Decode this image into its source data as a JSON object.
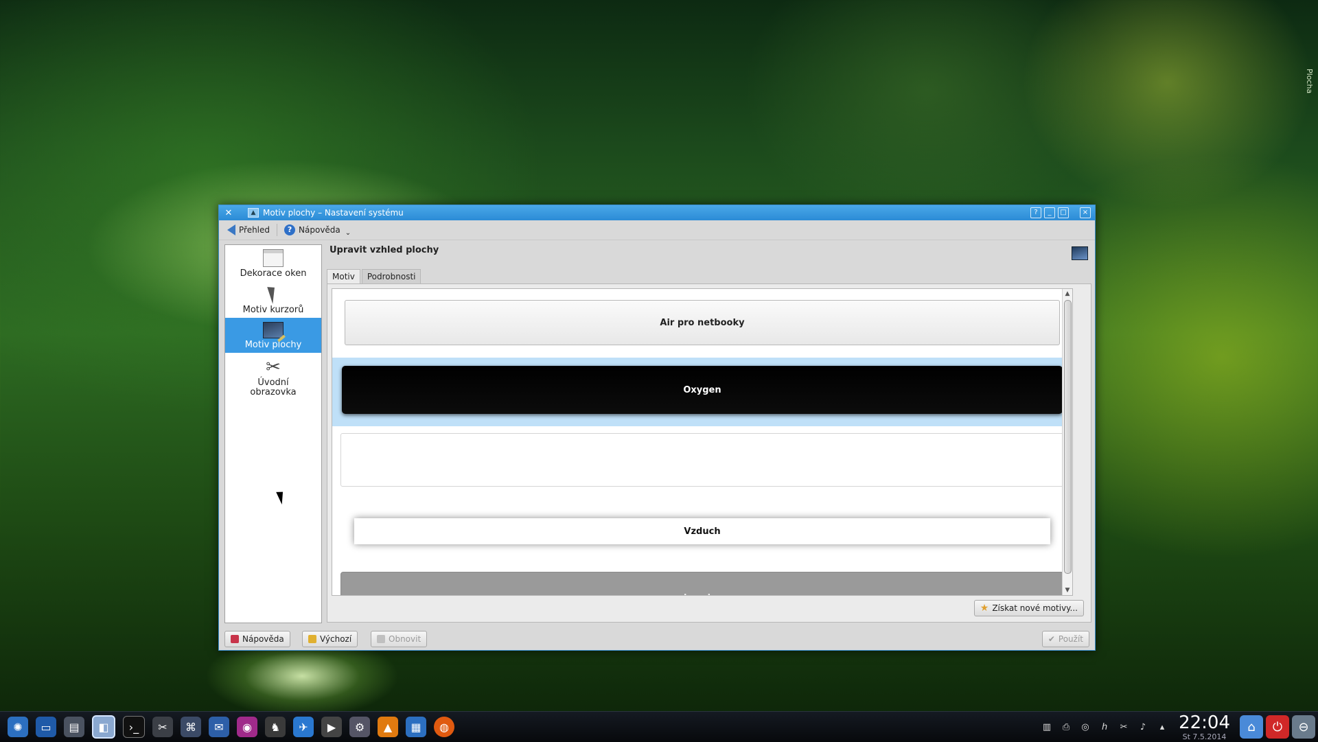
{
  "desktop": {
    "side_label": "Plocha"
  },
  "window": {
    "title": "Motiv plochy – Nastavení systému",
    "controls": [
      "?",
      "_",
      "□",
      "×"
    ],
    "toolbar": {
      "overview": "Přehled",
      "help": "Nápověda"
    }
  },
  "sidebar": {
    "items": [
      {
        "label": "Dekorace oken",
        "icon": "window-decoration-icon"
      },
      {
        "label": "Motiv kurzorů",
        "icon": "cursor-icon"
      },
      {
        "label": "Motiv plochy",
        "icon": "desktop-theme-icon",
        "active": true
      },
      {
        "label": "Úvodní obrazovka",
        "icon": "tools-icon"
      }
    ]
  },
  "main": {
    "title": "Upravit vzhled plochy",
    "tabs": [
      {
        "label": "Motiv",
        "active": true
      },
      {
        "label": "Podrobnosti",
        "active": false
      }
    ],
    "themes": [
      "Air pro netbooky",
      "Oxygen",
      "",
      "Vzduch",
      "glowglass"
    ],
    "get_new_button": "Získat nové motivy..."
  },
  "footer": {
    "help": "Nápověda",
    "defaults": "Výchozí",
    "reset": "Obnovit",
    "apply": "Použít"
  },
  "taskbar": {
    "clock": "22:04",
    "date": "St 7.5.2014",
    "apps": [
      "app-launcher",
      "desktop",
      "pager",
      "system-settings",
      "terminal",
      "tools",
      "network",
      "thunderbird",
      "eye",
      "mouse",
      "browser",
      "video",
      "config",
      "vlc",
      "writer",
      "firefox"
    ]
  },
  "colors": {
    "accent": "#3a9ae4",
    "titlebar": "#2b8bd6",
    "selection": "#bfe0f8"
  }
}
